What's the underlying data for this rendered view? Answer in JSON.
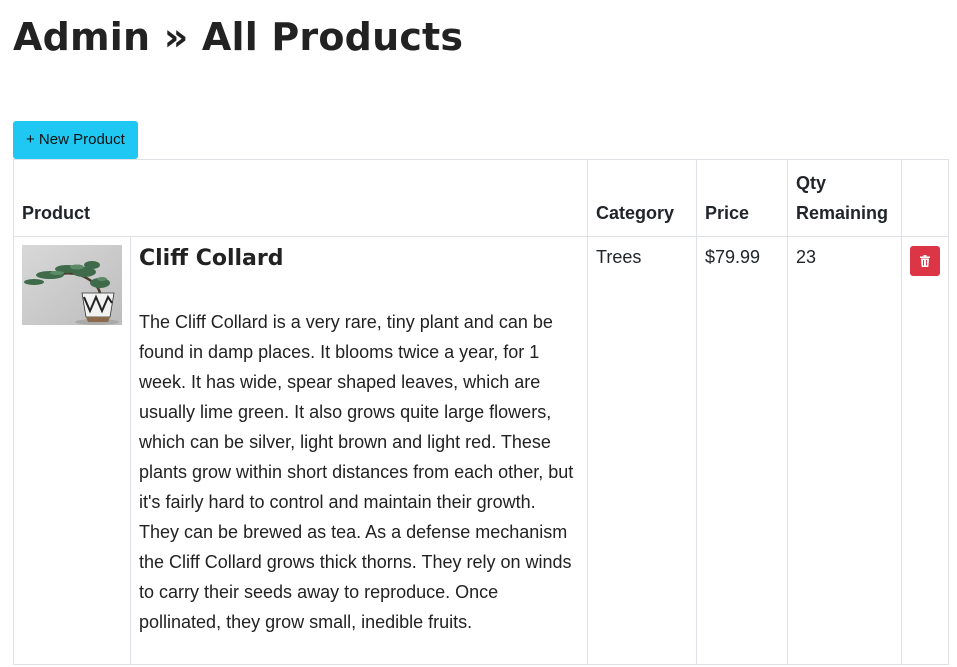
{
  "page": {
    "title": "Admin » All Products"
  },
  "toolbar": {
    "new_product_label": "+ New Product"
  },
  "table": {
    "headers": {
      "product": "Product",
      "category": "Category",
      "price": "Price",
      "qty": "Qty Remaining"
    },
    "rows": [
      {
        "image_icon": "bonsai-plant-image",
        "name": "Cliff Collard",
        "description": "The Cliff Collard is a very rare, tiny plant and can be found in damp places. It blooms twice a year, for 1 week. It has wide, spear shaped leaves, which are usually lime green. It also grows quite large flowers, which can be silver, light brown and light red. These plants grow within short distances from each other, but it's fairly hard to control and maintain their growth. They can be brewed as tea. As a defense mechanism the Cliff Collard grows thick thorns. They rely on winds to carry their seeds away to reproduce. Once pollinated, they grow small, inedible fruits.",
        "category": "Trees",
        "price": "$79.99",
        "qty": "23",
        "delete_icon": "trash-icon"
      }
    ]
  },
  "colors": {
    "new_button": "#1ec8f2",
    "delete_button": "#dc3545",
    "border": "#dee2e6"
  }
}
